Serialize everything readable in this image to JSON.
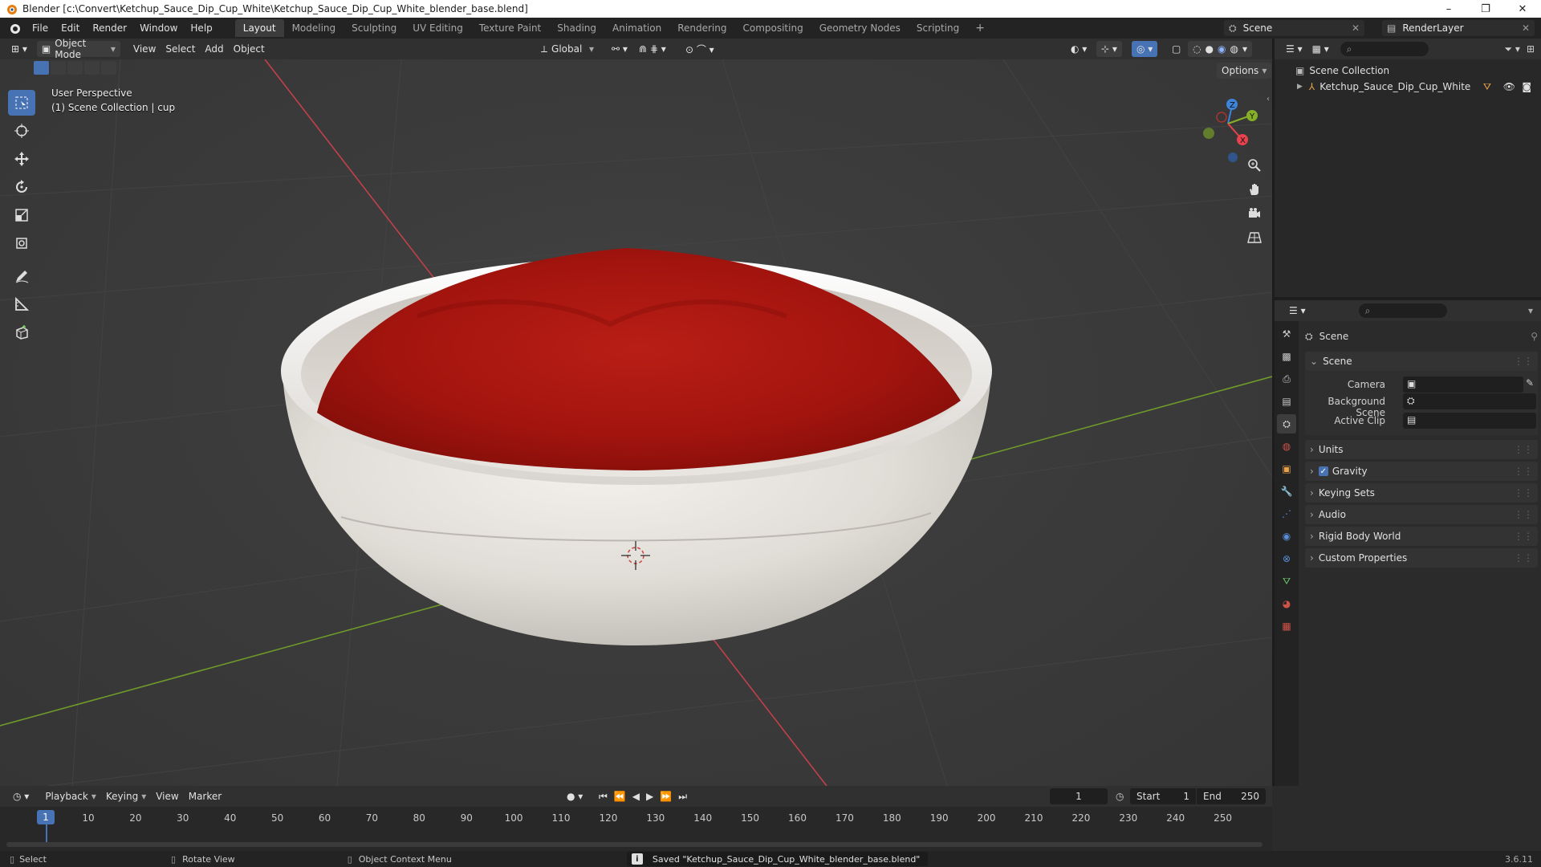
{
  "window": {
    "title": "Blender [c:\\Convert\\Ketchup_Sauce_Dip_Cup_White\\Ketchup_Sauce_Dip_Cup_White_blender_base.blend]",
    "controls": [
      "–",
      "❐",
      "✕"
    ]
  },
  "menu": [
    "File",
    "Edit",
    "Render",
    "Window",
    "Help"
  ],
  "workspaces": {
    "tabs": [
      "Layout",
      "Modeling",
      "Sculpting",
      "UV Editing",
      "Texture Paint",
      "Shading",
      "Animation",
      "Rendering",
      "Compositing",
      "Geometry Nodes",
      "Scripting"
    ],
    "active": "Layout",
    "add": "+"
  },
  "scene_selector": {
    "value": "Scene"
  },
  "view_layer": {
    "value": "RenderLayer"
  },
  "viewport_header": {
    "mode": "Object Mode",
    "menus": [
      "View",
      "Select",
      "Add",
      "Object"
    ],
    "transform_orientation": "Global",
    "options": "Options"
  },
  "viewport": {
    "perspective": "User Perspective",
    "collection_info": "(1) Scene Collection | cup"
  },
  "gizmo_axes": {
    "z": "Z",
    "y": "Y",
    "x": "X"
  },
  "outliner": {
    "root": "Scene Collection",
    "items": [
      {
        "label": "Ketchup_Sauce_Dip_Cup_White"
      }
    ]
  },
  "properties": {
    "header_title": "Scene",
    "panel_title": "Scene",
    "fields": [
      {
        "label": "Camera"
      },
      {
        "label": "Background Scene"
      },
      {
        "label": "Active Clip"
      }
    ],
    "sections": [
      "Units",
      "Gravity",
      "Keying Sets",
      "Audio",
      "Rigid Body World",
      "Custom Properties"
    ],
    "gravity_checked": true
  },
  "timeline": {
    "menus": [
      "Playback",
      "Keying",
      "View",
      "Marker"
    ],
    "current_frame": "1",
    "start_label": "Start",
    "start": "1",
    "end_label": "End",
    "end": "250",
    "ruler": [
      "10",
      "20",
      "30",
      "40",
      "50",
      "60",
      "70",
      "80",
      "90",
      "100",
      "110",
      "120",
      "130",
      "140",
      "150",
      "160",
      "170",
      "180",
      "190",
      "200",
      "210",
      "220",
      "230",
      "240",
      "250"
    ],
    "playhead": "1"
  },
  "statusbar": {
    "select": "Select",
    "rotate": "Rotate View",
    "context": "Object Context Menu",
    "message": "Saved \"Ketchup_Sauce_Dip_Cup_White_blender_base.blend\"",
    "version": "3.6.11"
  },
  "colors": {
    "accent": "#4772b3",
    "x_axis": "#e8424f",
    "y_axis": "#86b025",
    "z_axis": "#3e84d9",
    "sauce": "#a8140d",
    "bowl": "#e6e2dd"
  }
}
